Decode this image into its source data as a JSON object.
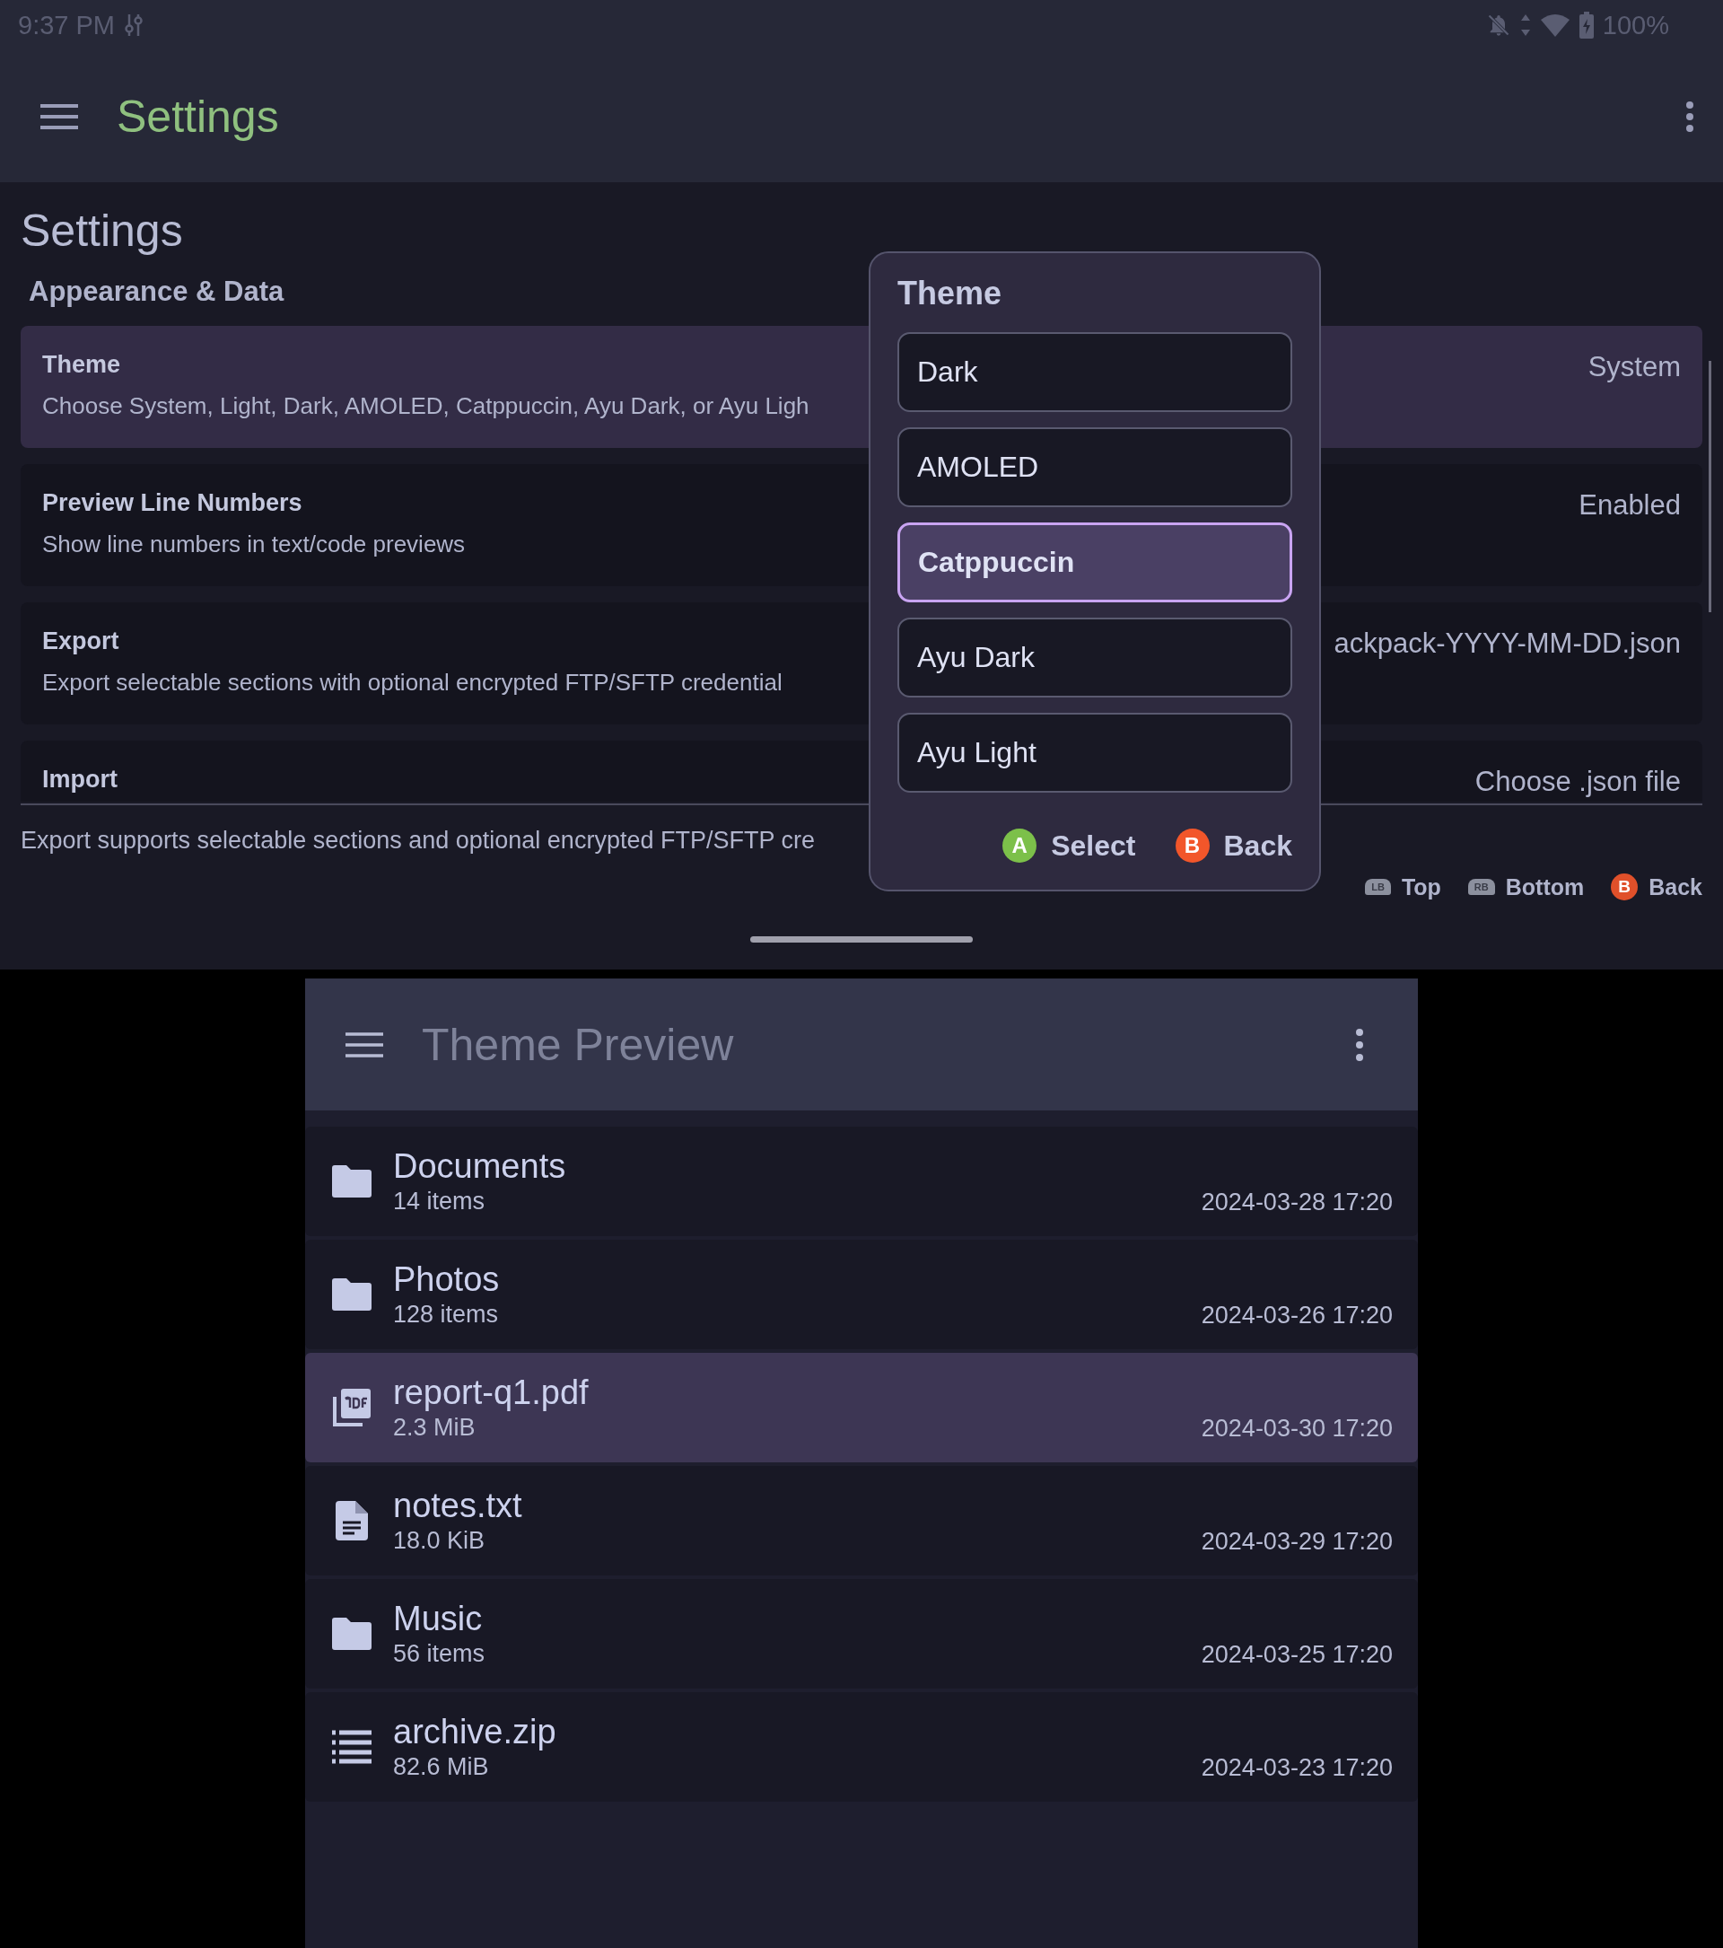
{
  "status_bar": {
    "time": "9:37 PM",
    "battery": "100%"
  },
  "app_bar": {
    "title": "Settings"
  },
  "page": {
    "heading": "Settings",
    "section": "Appearance & Data",
    "settings": [
      {
        "title": "Theme",
        "description": "Choose System, Light, Dark, AMOLED, Catppuccin, Ayu Dark, or Ayu Ligh",
        "value": "System",
        "selected": true
      },
      {
        "title": "Preview Line Numbers",
        "description": "Show line numbers in text/code previews",
        "value": "Enabled",
        "selected": false
      },
      {
        "title": "Export",
        "description": "Export selectable sections with optional encrypted FTP/SFTP credential",
        "value": "ackpack-YYYY-MM-DD.json",
        "selected": false
      },
      {
        "title": "Import",
        "value": "Choose .json file",
        "selected": false
      }
    ],
    "footer": "Export supports selectable sections and optional encrypted FTP/SFTP cre",
    "hints": [
      {
        "kind": "bumper",
        "key": "LB",
        "label": "Top"
      },
      {
        "kind": "bumper",
        "key": "RB",
        "label": "Bottom"
      },
      {
        "kind": "button",
        "key": "B",
        "label": "Back",
        "color": "#e0502a"
      }
    ]
  },
  "dialog": {
    "title": "Theme",
    "options": [
      {
        "label": "Dark",
        "selected": false
      },
      {
        "label": "AMOLED",
        "selected": false
      },
      {
        "label": "Catppuccin",
        "selected": true
      },
      {
        "label": "Ayu Dark",
        "selected": false
      },
      {
        "label": "Ayu Light",
        "selected": false
      }
    ],
    "actions": [
      {
        "key": "A",
        "label": "Select",
        "color": "#7cc04a"
      },
      {
        "key": "B",
        "label": "Back",
        "color": "#f2562a"
      }
    ]
  },
  "preview": {
    "title": "Theme Preview",
    "files": [
      {
        "kind": "folder",
        "name": "Documents",
        "detail": "14 items",
        "date": "2024-03-28 17:20",
        "selected": false
      },
      {
        "kind": "folder",
        "name": "Photos",
        "detail": "128 items",
        "date": "2024-03-26 17:20",
        "selected": false
      },
      {
        "kind": "pdf",
        "name": "report-q1.pdf",
        "detail": "2.3 MiB",
        "date": "2024-03-30 17:20",
        "selected": true
      },
      {
        "kind": "text",
        "name": "notes.txt",
        "detail": "18.0 KiB",
        "date": "2024-03-29 17:20",
        "selected": false
      },
      {
        "kind": "folder",
        "name": "Music",
        "detail": "56 items",
        "date": "2024-03-25 17:20",
        "selected": false
      },
      {
        "kind": "archive",
        "name": "archive.zip",
        "detail": "82.6 MiB",
        "date": "2024-03-23 17:20",
        "selected": false
      }
    ]
  }
}
